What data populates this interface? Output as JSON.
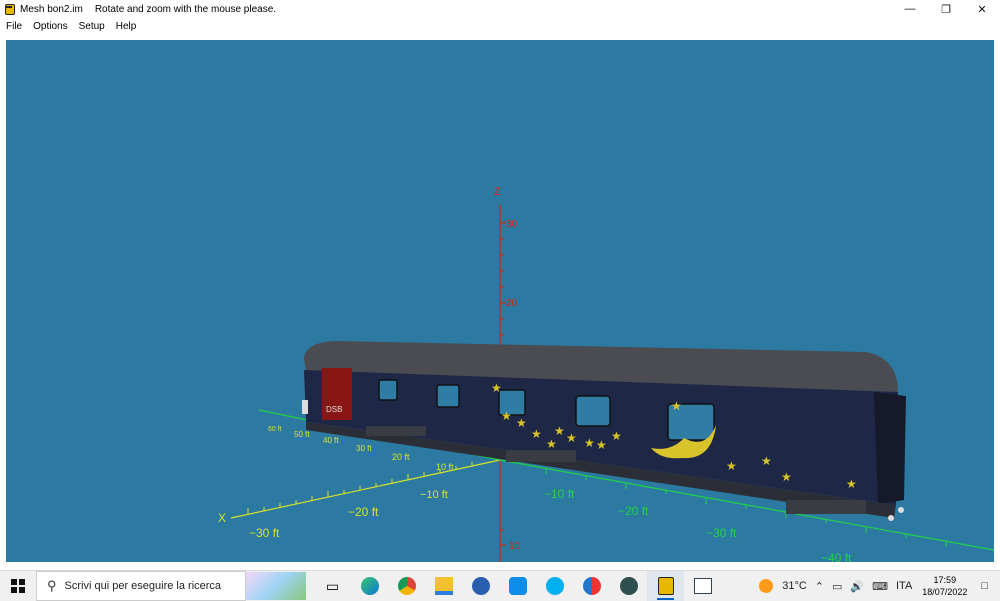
{
  "window": {
    "app_title": "Mesh bon2.im",
    "hint": "Rotate and zoom with the mouse please.",
    "minimize_icon": "minimize-icon",
    "restore_icon": "restore-icon",
    "close_icon": "close-icon"
  },
  "menu": {
    "items": [
      "File",
      "Options",
      "Setup",
      "Help"
    ]
  },
  "viewport": {
    "background": "#2c7aa1",
    "z_axis": {
      "label": "Z",
      "ticks": [
        "30",
        "20",
        "10"
      ]
    },
    "x_axis": {
      "label": "X",
      "ticks": [
        "−30 ft",
        "−20 ft",
        "−10 ft",
        "10 ft",
        "20 ft",
        "30 ft",
        "40 ft",
        "50 ft",
        "60 ft"
      ]
    },
    "y_axis": {
      "ticks": [
        "−10 ft",
        "−20 ft",
        "−30 ft",
        "−40 ft"
      ]
    },
    "car": {
      "logo": "DSB",
      "body_color": "#1e2746",
      "roof_color": "#4a4c52",
      "star_color": "#d8c42a"
    }
  },
  "taskbar": {
    "search_placeholder": "Scrivi qui per eseguire la ricerca",
    "weather": "31°C",
    "language": "ITA",
    "time": "17:59",
    "date": "18/07/2022",
    "icons": [
      "task-view-icon",
      "edge-icon",
      "chrome-icon",
      "file-explorer-icon",
      "github-icon",
      "teamviewer-icon",
      "skype-icon",
      "app-icon",
      "terminal-icon",
      "mesh-viewer-icon",
      "editor-icon"
    ]
  }
}
